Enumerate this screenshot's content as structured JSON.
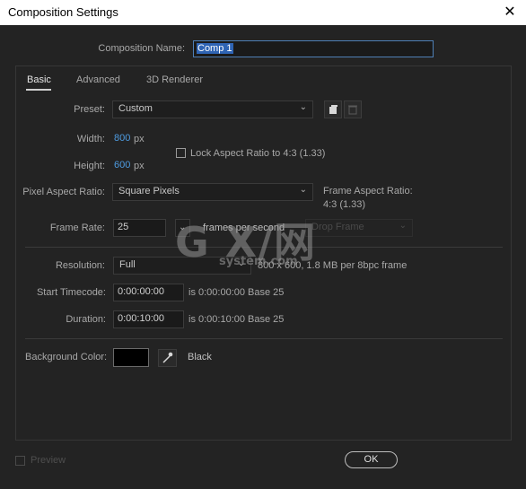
{
  "window": {
    "title": "Composition Settings",
    "close_glyph": "✕"
  },
  "composition_name": {
    "label": "Composition Name:",
    "value": "Comp 1"
  },
  "tabs": [
    {
      "label": "Basic",
      "active": true
    },
    {
      "label": "Advanced",
      "active": false
    },
    {
      "label": "3D Renderer",
      "active": false
    }
  ],
  "preset": {
    "label": "Preset:",
    "value": "Custom"
  },
  "width": {
    "label": "Width:",
    "value": "800",
    "unit": "px"
  },
  "height": {
    "label": "Height:",
    "value": "600",
    "unit": "px"
  },
  "lock_aspect": {
    "label": "Lock Aspect Ratio to 4:3 (1.33)",
    "checked": false
  },
  "pixel_aspect": {
    "label": "Pixel Aspect Ratio:",
    "value": "Square Pixels"
  },
  "frame_aspect": {
    "label": "Frame Aspect Ratio:",
    "value": "4:3 (1.33)"
  },
  "frame_rate": {
    "label": "Frame Rate:",
    "value": "25",
    "unit": "frames per second",
    "drop_frame": "Drop Frame"
  },
  "resolution": {
    "label": "Resolution:",
    "value": "Full",
    "info": "800 x 600, 1.8 MB per 8bpc frame"
  },
  "start_timecode": {
    "label": "Start Timecode:",
    "value": "0:00:00:00",
    "info": "is 0:00:00:00",
    "base": "Base 25"
  },
  "duration": {
    "label": "Duration:",
    "value": "0:00:10:00",
    "info": "is 0:00:10:00",
    "base": "Base 25"
  },
  "background_color": {
    "label": "Background Color:",
    "swatch": "#000000",
    "name": "Black"
  },
  "preview": {
    "label": "Preview",
    "checked": false
  },
  "ok_button": {
    "label": "OK"
  },
  "watermark": {
    "main": "G X/网",
    "sub": "system.com"
  },
  "colors": {
    "accent": "#4e9be0",
    "background": "#232323",
    "titlebar": "#ffffff"
  }
}
